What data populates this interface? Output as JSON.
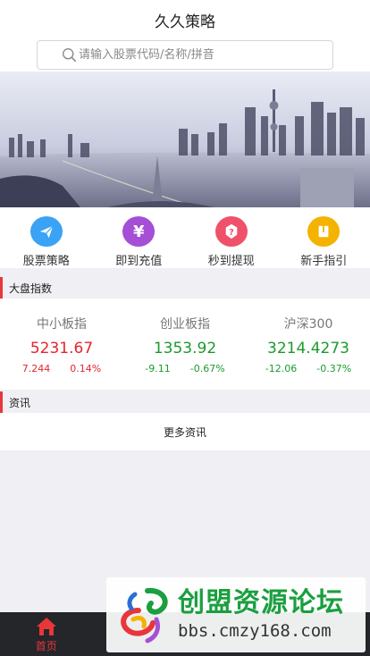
{
  "header": {
    "title": "久久策略"
  },
  "search": {
    "placeholder": "请输入股票代码/名称/拼音",
    "icon": "search-icon"
  },
  "quick": [
    {
      "label": "股票策略",
      "icon": "paper-plane-icon",
      "color": "#3aa3f5"
    },
    {
      "label": "即到充值",
      "icon": "yen-icon",
      "color": "#a54fd6"
    },
    {
      "label": "秒到提现",
      "icon": "question-badge-icon",
      "color": "#f0516a"
    },
    {
      "label": "新手指引",
      "icon": "book-icon",
      "color": "#f4b300"
    }
  ],
  "market": {
    "title": "大盘指数",
    "indices": [
      {
        "name": "中小板指",
        "value": "5231.67",
        "change": "7.244",
        "percent": "0.14%",
        "trend": "up"
      },
      {
        "name": "创业板指",
        "value": "1353.92",
        "change": "-9.11",
        "percent": "-0.67%",
        "trend": "down"
      },
      {
        "name": "沪深300",
        "value": "3214.4273",
        "change": "-12.06",
        "percent": "-0.37%",
        "trend": "down"
      }
    ]
  },
  "news": {
    "title": "资讯",
    "more": "更多资讯"
  },
  "tabbar": {
    "active_label": "首页",
    "icon": "home-icon",
    "accent": "#e8363b"
  },
  "watermark": {
    "title": "创盟资源论坛",
    "url": "bbs.cmzy168.com"
  }
}
